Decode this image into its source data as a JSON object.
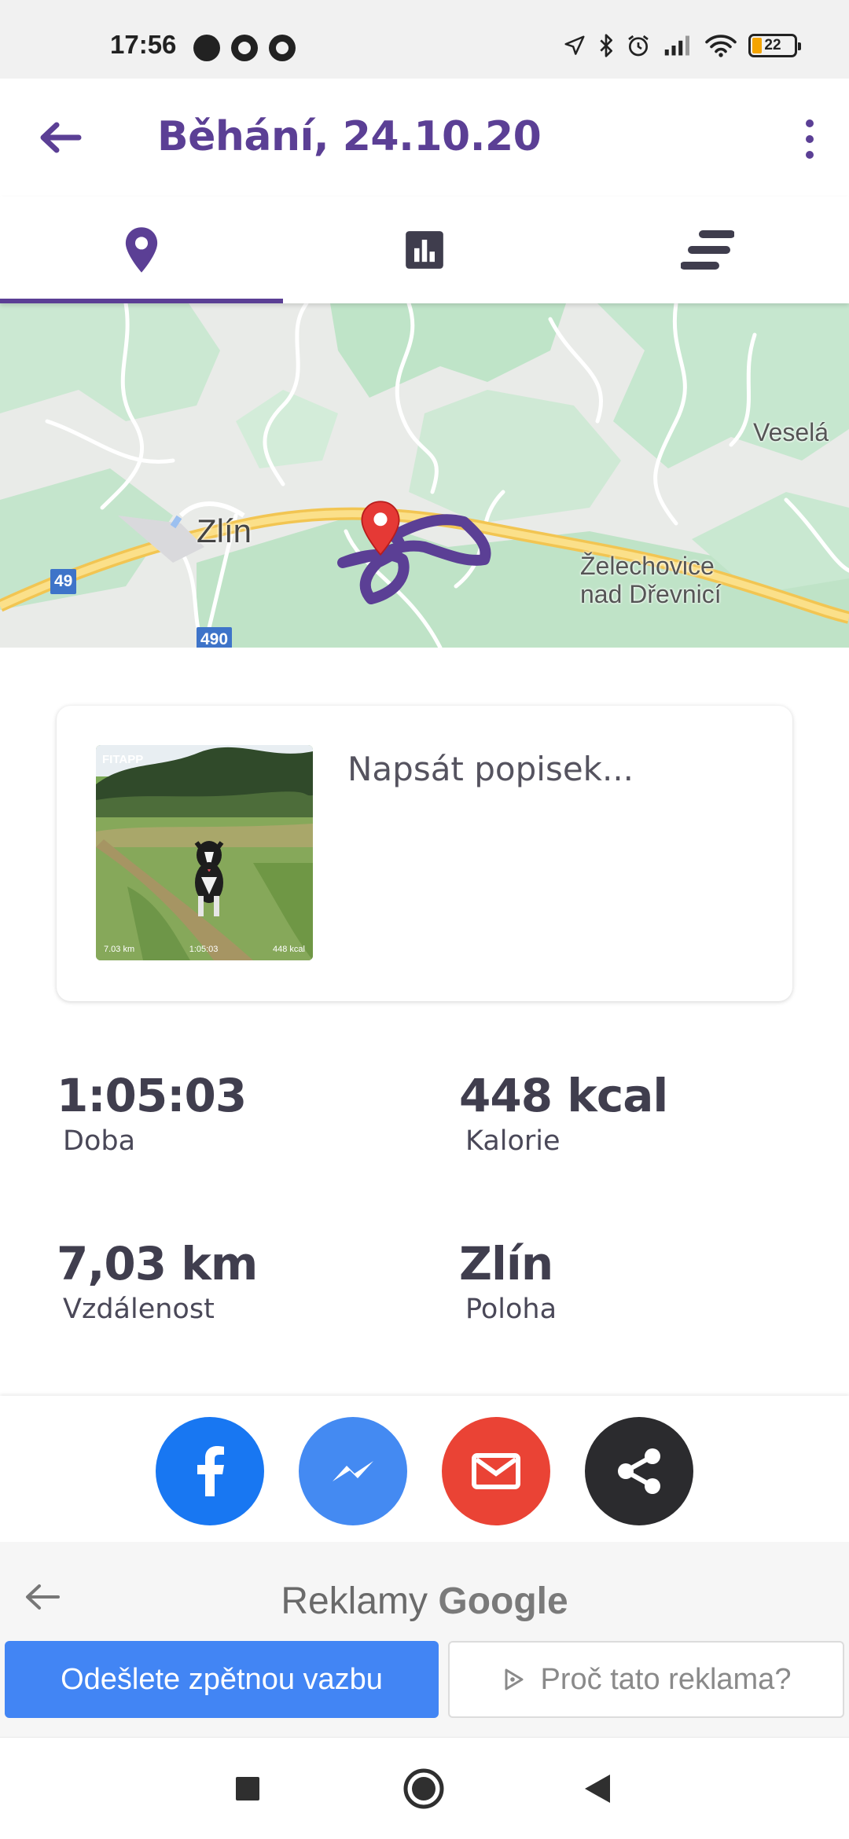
{
  "status_bar": {
    "time": "17:56",
    "battery": "22"
  },
  "app_bar": {
    "title": "Běhání, 24.10.20"
  },
  "tabs": [
    {
      "name": "map-pin-icon",
      "active": true
    },
    {
      "name": "bar-chart-icon",
      "active": false
    },
    {
      "name": "list-lines-icon",
      "active": false
    }
  ],
  "map": {
    "labels": {
      "city": "Zlín",
      "village1": "Veselá",
      "village2_line1": "Želechovice",
      "village2_line2": "nad Dřevnicí"
    },
    "roads": {
      "r1": "49",
      "r2": "490"
    }
  },
  "card": {
    "caption_placeholder": "Napsát popisek...",
    "photo": {
      "logo": "FITAPP",
      "distance": "7.03 km",
      "duration": "1:05:03",
      "calories": "448 kcal"
    }
  },
  "stats": {
    "duration_value": "1:05:03",
    "duration_label": "Doba",
    "calories_value": "448 kcal",
    "calories_label": "Kalorie",
    "distance_value": "7,03 km",
    "distance_label": "Vzdálenost",
    "location_value": "Zlín",
    "location_label": "Poloha"
  },
  "share": {
    "colors": {
      "facebook": "#1877f2",
      "messenger": "#448af2",
      "email": "#ea4335",
      "share": "#2b2b2e"
    }
  },
  "ad": {
    "title_prefix": "Reklamy ",
    "title_brand": "Google",
    "feedback_button": "Odešlete zpětnou vazbu",
    "why_button": "Proč tato reklama?"
  },
  "colors": {
    "accent": "#5b3f95",
    "marker": "#e53935"
  }
}
